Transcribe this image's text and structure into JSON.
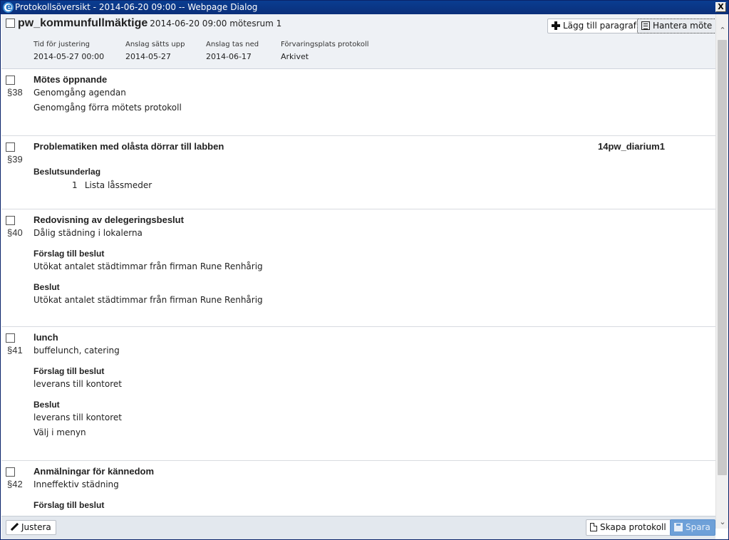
{
  "window": {
    "title": "Protokollsöversikt - 2014-06-20 09:00 -- Webpage Dialog",
    "close_label": "X"
  },
  "header": {
    "meeting_name": "pw_kommunfullmäktige",
    "meeting_sub": "2014-06-20 09:00 mötesrum 1",
    "add_paragraph_label": "Lägg till paragraf",
    "manage_meeting_label": "Hantera möte",
    "meta": [
      {
        "label": "Tid för justering",
        "value": "2014-05-27 00:00"
      },
      {
        "label": "Anslag sätts upp",
        "value": "2014-05-27"
      },
      {
        "label": "Anslag tas ned",
        "value": "2014-06-17"
      },
      {
        "label": "Förvaringsplats protokoll",
        "value": "Arkivet"
      }
    ]
  },
  "items": [
    {
      "number": "§38",
      "title": "Mötes öppnande",
      "lines": [
        "Genomgång agendan",
        "Genomgång förra mötets protokoll"
      ]
    },
    {
      "number": "§39",
      "title": "Problematiken med olåsta dörrar till labben",
      "diarie": "14pw_diarium1",
      "basis_label": "Beslutsunderlag",
      "attachments": [
        {
          "index": "1",
          "name": "Lista låssmeder"
        }
      ]
    },
    {
      "number": "§40",
      "title": "Redovisning av delegeringsbeslut",
      "lines": [
        "Dålig städning i lokalerna"
      ],
      "proposal_label": "Förslag till beslut",
      "proposal": [
        "Utökat antalet städtimmar från firman Rune Renhårig"
      ],
      "decision_label": "Beslut",
      "decision": [
        "Utökat antalet städtimmar från firman Rune Renhårig"
      ]
    },
    {
      "number": "§41",
      "title": "lunch",
      "lines": [
        "buffelunch, catering"
      ],
      "proposal_label": "Förslag till beslut",
      "proposal": [
        "leverans till kontoret"
      ],
      "decision_label": "Beslut",
      "decision": [
        "leverans till kontoret",
        "Välj i menyn"
      ]
    },
    {
      "number": "§42",
      "title": "Anmälningar för kännedom",
      "lines": [
        "Inneffektiv städning"
      ],
      "proposal_label": "Förslag till beslut"
    }
  ],
  "footer": {
    "adjust_label": "Justera",
    "create_protocol_label": "Skapa protokoll",
    "save_label": "Spara"
  }
}
